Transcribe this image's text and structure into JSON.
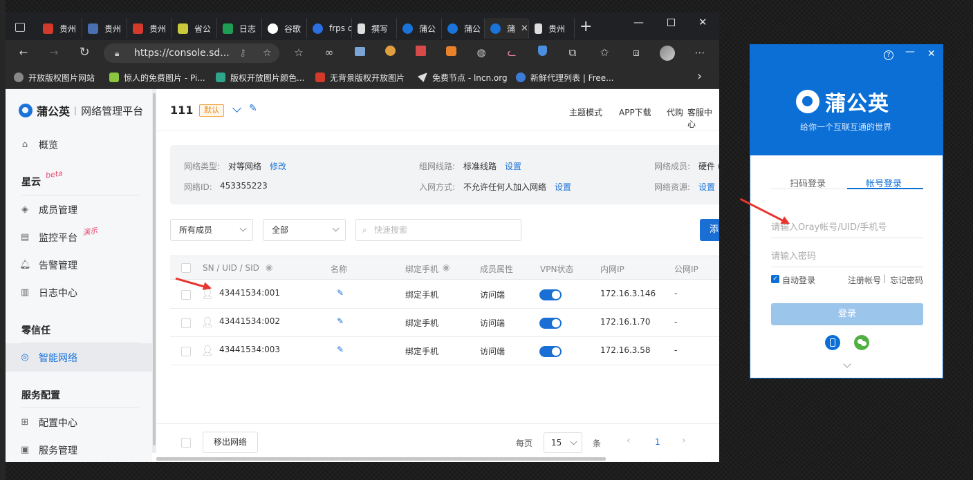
{
  "browser": {
    "tabs": [
      {
        "label": "贵州",
        "color": "#d33a2c"
      },
      {
        "label": "贵州",
        "color": "#4a6fb0"
      },
      {
        "label": "贵州",
        "color": "#d33a2c"
      },
      {
        "label": "省公",
        "color": "#c9c93a"
      },
      {
        "label": "日志",
        "color": "#1e9e54"
      },
      {
        "label": "谷歌",
        "color": "#ffffff"
      },
      {
        "label": "frps c",
        "color": "#2b6fe0"
      },
      {
        "label": "撰写",
        "color": "#dddddd"
      },
      {
        "label": "蒲公",
        "color": "#1a73d9"
      },
      {
        "label": "蒲公",
        "color": "#1a73d9"
      },
      {
        "label": "蒲",
        "color": "#1a73d9"
      },
      {
        "label": "贵州",
        "color": "#dddddd"
      }
    ],
    "new_tab": "+",
    "url": "https://console.sd...",
    "favorites": [
      {
        "label": "开放版权图片网站",
        "color": "#888888"
      },
      {
        "label": "惊人的免费图片 - Pi...",
        "color": "#8cc63f"
      },
      {
        "label": "版权开放图片颜色...",
        "color": "#2fa58b"
      },
      {
        "label": "无背景版权开放图片",
        "color": "#d33a2c"
      },
      {
        "label": "免费节点 - lncn.org",
        "color": "#dddddd"
      },
      {
        "label": "新鲜代理列表 | Free...",
        "color": "#3d7bd9"
      }
    ],
    "fav_more": "›"
  },
  "sidebar": {
    "logo": "蒲公英",
    "platform": "网络管理平台",
    "overview": "概览",
    "group_xingyun": "星云",
    "beta_tag": "beta",
    "items_xingyun": [
      "成员管理",
      "监控平台",
      "告警管理",
      "日志中心"
    ],
    "demo_tag": "演示",
    "group_zero": "零信任",
    "active_item": "智能网络",
    "group_service": "服务配置",
    "items_service": [
      "配置中心",
      "服务管理"
    ]
  },
  "header": {
    "network_name": "111",
    "default_badge": "默认",
    "links": [
      "主题模式",
      "APP下载",
      "代购",
      "客服中心"
    ]
  },
  "info": {
    "type_label": "网络类型:",
    "type_value": "对等网络",
    "type_action": "修改",
    "id_label": "网络ID:",
    "id_value": "453355223",
    "route_label": "组网线路:",
    "route_value": "标准线路",
    "route_action": "设置",
    "join_label": "入网方式:",
    "join_value": "不允许任何人加入网络",
    "join_action": "设置",
    "members_label": "网络成员:",
    "members_value": "硬件 (",
    "resources_label": "网络资源:",
    "resources_action": "设置"
  },
  "filters": {
    "member_select": "所有成员",
    "status_select": "全部",
    "search_placeholder": "快速搜索",
    "add_button": "添"
  },
  "table": {
    "headers": [
      "SN / UID / SID",
      "名称",
      "绑定手机",
      "成员属性",
      "VPN状态",
      "内网IP",
      "公网IP"
    ],
    "rows": [
      {
        "sn": "43441534:001",
        "phone": "绑定手机",
        "attr": "访问端",
        "vpn_on": true,
        "ip": "172.16.3.146",
        "public_ip": "-"
      },
      {
        "sn": "43441534:002",
        "phone": "绑定手机",
        "attr": "访问端",
        "vpn_on": true,
        "ip": "172.16.1.70",
        "public_ip": "-"
      },
      {
        "sn": "43441534:003",
        "phone": "绑定手机",
        "attr": "访问端",
        "vpn_on": true,
        "ip": "172.16.3.58",
        "public_ip": "-"
      }
    ]
  },
  "footer": {
    "remove_button": "移出网络",
    "per_page_label": "每页",
    "per_page_value": "15",
    "unit": "条",
    "current_page": "1"
  },
  "login": {
    "help": "?",
    "logo": "蒲公英",
    "slogan": "给你一个互联互通的世界",
    "tab_qr": "扫码登录",
    "tab_account": "帐号登录",
    "account_placeholder": "请输入Oray帐号/UID/手机号",
    "password_placeholder": "请输入密码",
    "auto_login": "自动登录",
    "register": "注册帐号",
    "separator": "|",
    "forgot": "忘记密码",
    "login_button": "登录"
  }
}
